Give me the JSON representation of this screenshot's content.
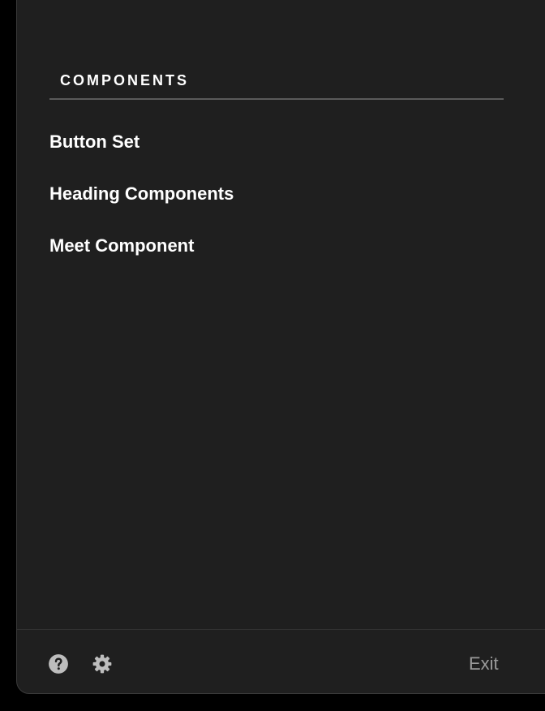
{
  "sidebar": {
    "section_title": "COMPONENTS",
    "items": [
      {
        "label": "Button Set"
      },
      {
        "label": "Heading Components"
      },
      {
        "label": "Meet Component"
      }
    ]
  },
  "footer": {
    "help_icon": "question-circle-icon",
    "settings_icon": "gear-icon",
    "exit_label": "Exit"
  },
  "colors": {
    "panel_bg": "#1f1f1f",
    "page_bg": "#000000",
    "text_primary": "#ffffff",
    "text_muted": "#9a9a9a",
    "icon": "#bdbdbd"
  }
}
